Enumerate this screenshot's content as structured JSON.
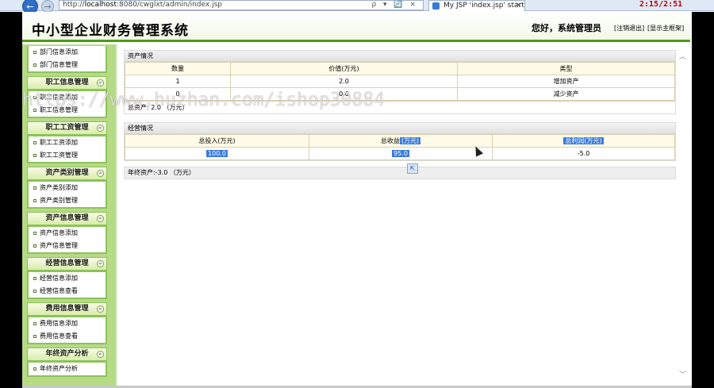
{
  "browser": {
    "back_glyph": "←",
    "fwd_glyph": "→",
    "address_prefix": "http://",
    "address_host": "localhost",
    "address_rest": ":8080/cwglxt/admin/index.jsp",
    "addr_icons": "ρ ▾ 🔄 ×",
    "tab_title": "My JSP 'index.jsp' startin...",
    "tab_close": "×",
    "clock": "2:15/2:51"
  },
  "header": {
    "title": "中小型企业财务管理系统",
    "greeting": "您好，系统管理员",
    "logout": "[注销退出]",
    "home": "[显示主框架]"
  },
  "sidebar": {
    "top_items": [
      "部门信息添加",
      "部门信息管理"
    ],
    "groups": [
      {
        "title": "职工信息管理",
        "items": [
          "职工信息添加",
          "职工信息管理"
        ]
      },
      {
        "title": "职工工资管理",
        "items": [
          "职工工资添加",
          "职工工资管理"
        ]
      },
      {
        "title": "资产类别管理",
        "items": [
          "资产类别添加",
          "资产类别管理"
        ]
      },
      {
        "title": "资产信息管理",
        "items": [
          "资产信息添加",
          "资产信息管理"
        ]
      },
      {
        "title": "经营信息管理",
        "items": [
          "经营信息添加",
          "经营信息查看"
        ]
      },
      {
        "title": "费用信息管理",
        "items": [
          "费用信息添加",
          "费用信息查看"
        ]
      },
      {
        "title": "年终资产分析",
        "items": [
          "年终资产分析"
        ]
      }
    ],
    "collapse_glyph": "«"
  },
  "assets": {
    "title": "资产情况",
    "headers": [
      "数量",
      "价值(万元)",
      "类型"
    ],
    "rows": [
      [
        "1",
        "2.0",
        "增加资产"
      ],
      [
        "0",
        "0.0",
        "减少资产"
      ]
    ],
    "summary": "总资产: 2.0 （万元）"
  },
  "business": {
    "title": "经营情况",
    "h1": "总投入(万元)",
    "h2_plain": "总收益",
    "h2_hl": "(万元)",
    "h3_hl": "总利润(万元)",
    "v1": "100.0",
    "v2": "95.0",
    "v3": "-5.0"
  },
  "year_end": "年终资产:-3.0 （万元）",
  "watermark": "https://www.huzhan.com/ishop30884",
  "scroll": {
    "up": "︿",
    "down": "﹀"
  },
  "move_glyph": "⇱"
}
